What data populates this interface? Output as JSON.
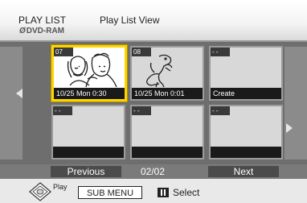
{
  "header": {
    "title": "PLAY LIST",
    "subtitle": "Play List View",
    "disc_icon": "Ø",
    "disc_label": "DVD-RAM"
  },
  "tiles": [
    {
      "number": "07",
      "caption": "10/25 Mon  0:30",
      "selected": true,
      "thumbnail": "couple-icon"
    },
    {
      "number": "08",
      "caption": "10/25 Mon  0:01",
      "selected": false,
      "thumbnail": "dinosaur-icon"
    },
    {
      "number": "- -",
      "caption": "Create",
      "selected": false
    },
    {
      "number": "- -",
      "caption": "",
      "selected": false
    },
    {
      "number": "- -",
      "caption": "",
      "selected": false
    },
    {
      "number": "- -",
      "caption": "",
      "selected": false
    }
  ],
  "nav": {
    "previous_label": "Previous",
    "page_indicator": "02/02",
    "next_label": "Next"
  },
  "legend": {
    "play_label": "Play",
    "submenu_label": "SUB MENU",
    "select_label": "Select"
  },
  "colors": {
    "selection_border": "#ffd400",
    "grid_background": "#6e6e6e",
    "caption_bar": "#1a1a1a"
  }
}
